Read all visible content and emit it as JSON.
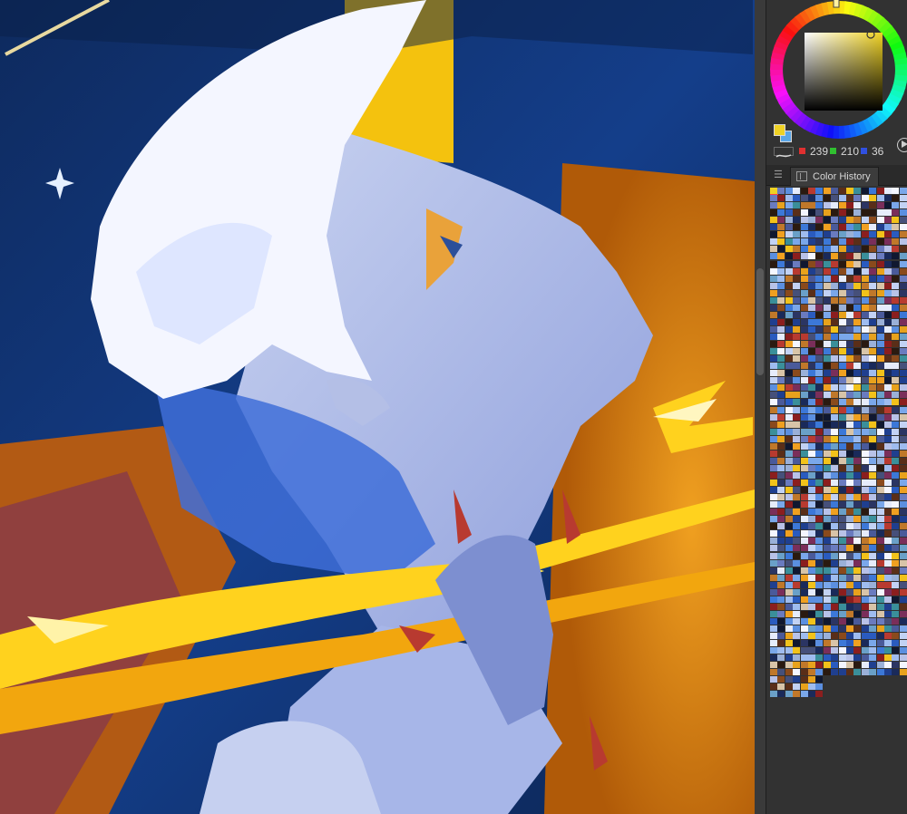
{
  "color_panel": {
    "rgb": {
      "r": "239",
      "g": "210",
      "b": "36"
    },
    "current_color": "#efd224",
    "channel_colors": {
      "r": "#e03030",
      "g": "#30c030",
      "b": "#3050e0"
    }
  },
  "color_history_panel": {
    "tab_label": "Color History",
    "icons": {
      "tab": "palette-tab-icon",
      "menu": "panel-menu-icon"
    }
  },
  "icons": {
    "play": "play-icon",
    "fg_bg": "foreground-background-swatch-icon",
    "brush_stroke": "brush-stroke-icon"
  }
}
